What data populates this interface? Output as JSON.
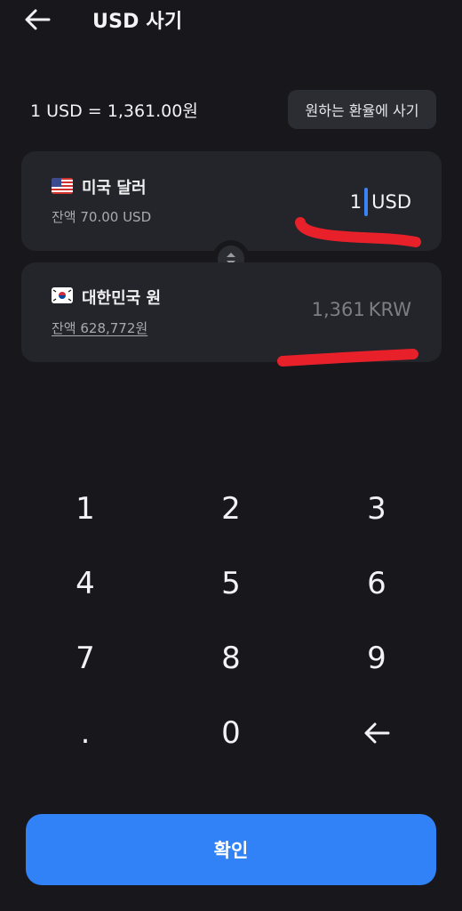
{
  "header": {
    "back_icon": "arrow-left-icon",
    "title": "USD 사기"
  },
  "rate": {
    "text": "1 USD = 1,361.00원",
    "custom_rate_button": "원하는 환율에 사기"
  },
  "from_card": {
    "flag_icon": "us-flag-icon",
    "currency_name": "미국 달러",
    "balance": "잔액 70.00 USD",
    "amount": "1",
    "unit": "USD"
  },
  "swap": {
    "icon": "swap-vertical-icon"
  },
  "to_card": {
    "flag_icon": "kr-flag-icon",
    "currency_name": "대한민국 원",
    "balance": "잔액 628,772원",
    "amount": "1,361",
    "unit": "KRW"
  },
  "keypad": {
    "keys": [
      "1",
      "2",
      "3",
      "4",
      "5",
      "6",
      "7",
      "8",
      "9",
      ".",
      "0"
    ],
    "backspace_icon": "backspace-arrow-icon"
  },
  "confirm_button": "확인",
  "colors": {
    "background": "#18181c",
    "card": "#24252b",
    "accent": "#3182f6",
    "cursor": "#3b82f6",
    "annotation": "#e8202a"
  }
}
